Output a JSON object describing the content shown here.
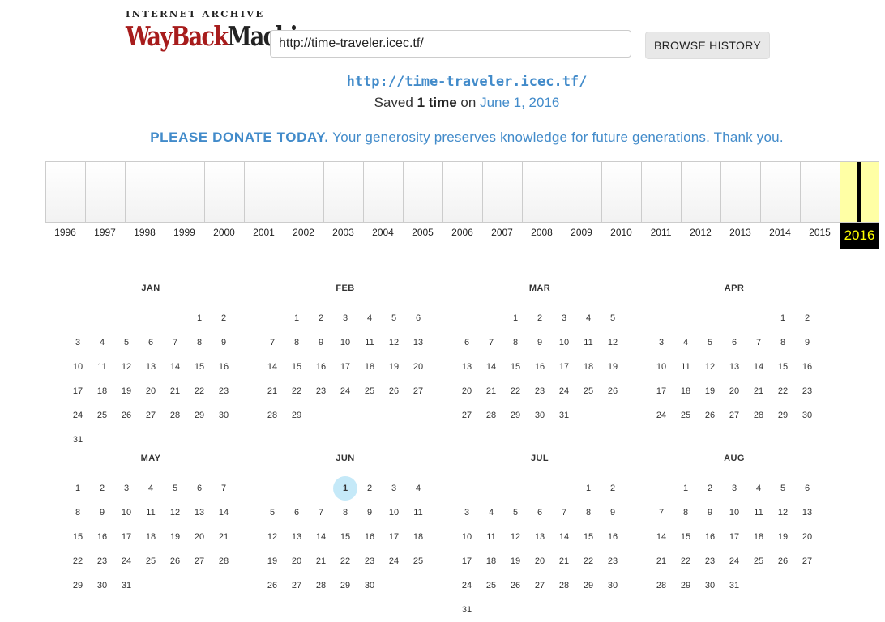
{
  "header": {
    "logo_top": "INTERNET ARCHIVE",
    "logo_wayback": "WayBack",
    "logo_machine": "Machine",
    "url_value": "http://time-traveler.icec.tf/",
    "browse_label": "BROWSE HISTORY"
  },
  "summary": {
    "site_link": "http://time-traveler.icec.tf/",
    "saved_prefix": "Saved ",
    "saved_count": "1 time",
    "saved_on": " on ",
    "saved_date": "June 1, 2016"
  },
  "donate": {
    "bold": "PLEASE DONATE TODAY.",
    "text": " Your generosity preserves knowledge for future generations. Thank you."
  },
  "timeline": {
    "years": [
      "1996",
      "1997",
      "1998",
      "1999",
      "2000",
      "2001",
      "2002",
      "2003",
      "2004",
      "2005",
      "2006",
      "2007",
      "2008",
      "2009",
      "2010",
      "2011",
      "2012",
      "2013",
      "2014",
      "2015",
      "2016"
    ],
    "selected_year": "2016",
    "capture_year_index": 20
  },
  "calendar": {
    "months": [
      {
        "name": "JAN",
        "start": 5,
        "days": 31
      },
      {
        "name": "FEB",
        "start": 1,
        "days": 29
      },
      {
        "name": "MAR",
        "start": 2,
        "days": 31
      },
      {
        "name": "APR",
        "start": 5,
        "days": 30
      },
      {
        "name": "MAY",
        "start": 0,
        "days": 31
      },
      {
        "name": "JUN",
        "start": 3,
        "days": 30,
        "captures": [
          1
        ]
      },
      {
        "name": "JUL",
        "start": 5,
        "days": 31
      },
      {
        "name": "AUG",
        "start": 1,
        "days": 31
      }
    ]
  }
}
